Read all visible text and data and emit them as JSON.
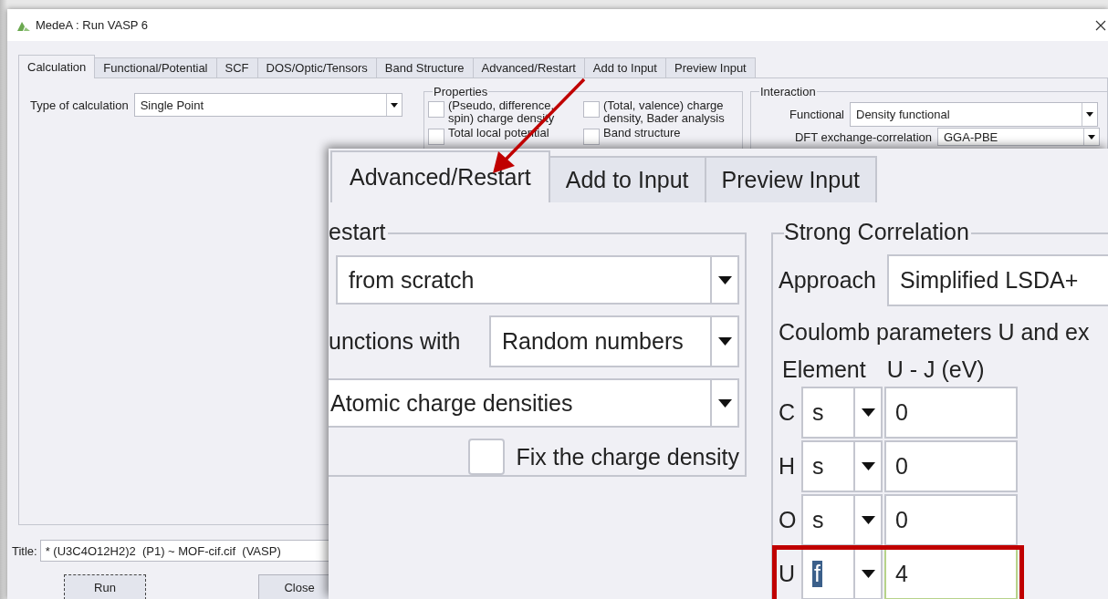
{
  "window": {
    "title": "MedeA : Run VASP 6"
  },
  "tabs": [
    {
      "label": "Calculation",
      "selected": true
    },
    {
      "label": "Functional/Potential",
      "selected": false
    },
    {
      "label": "SCF",
      "selected": false
    },
    {
      "label": "DOS/Optic/Tensors",
      "selected": false
    },
    {
      "label": "Band Structure",
      "selected": false
    },
    {
      "label": "Advanced/Restart",
      "selected": false
    },
    {
      "label": "Add to Input",
      "selected": false
    },
    {
      "label": "Preview Input",
      "selected": false
    }
  ],
  "calculation": {
    "label": "Type of calculation",
    "value": "Single Point"
  },
  "properties": {
    "title": "Properties",
    "options": [
      {
        "label": "(Pseudo, difference, spin) charge density",
        "checked": false
      },
      {
        "label": "(Total, valence) charge density, Bader analysis",
        "checked": false
      },
      {
        "label": "Total local potential",
        "checked": false
      },
      {
        "label": "Band structure",
        "checked": false
      }
    ]
  },
  "interaction": {
    "title": "Interaction",
    "fields": [
      {
        "label": "Functional",
        "value": "Density functional"
      },
      {
        "label": "DFT exchange-correlation",
        "value": "GGA-PBE"
      }
    ]
  },
  "title_field": {
    "label": "Title:",
    "value": "* (U3C4O12H2)2  (P1) ~ MOF-cif.cif  (VASP)"
  },
  "buttons": [
    {
      "label": "Run",
      "focused": true
    },
    {
      "label": "Close",
      "focused": false
    }
  ],
  "zoom_inset": {
    "tabs": [
      {
        "label": "Advanced/Restart",
        "selected": true
      },
      {
        "label": "Add to Input",
        "selected": false
      },
      {
        "label": "Preview Input",
        "selected": false
      }
    ],
    "restart": {
      "title": "estart",
      "start": "from scratch",
      "wave_label": "unctions with",
      "wave_value": "Random numbers",
      "charge_value": "Atomic charge densities",
      "fix_label": "Fix the charge density",
      "fix_checked": false
    },
    "strong_correlation": {
      "title": "Strong Correlation",
      "approach_label": "Approach",
      "approach_value": "Simplified LSDA+",
      "coulomb_label": "Coulomb parameters U and ex",
      "columns": [
        "Element",
        "U - J (eV)"
      ],
      "rows": [
        {
          "element": "C",
          "orbital": "s",
          "value": "0",
          "highlighted": false
        },
        {
          "element": "H",
          "orbital": "s",
          "value": "0",
          "highlighted": false
        },
        {
          "element": "O",
          "orbital": "s",
          "value": "0",
          "highlighted": false
        },
        {
          "element": "U",
          "orbital": "f",
          "value": "4",
          "highlighted": true
        }
      ]
    }
  }
}
